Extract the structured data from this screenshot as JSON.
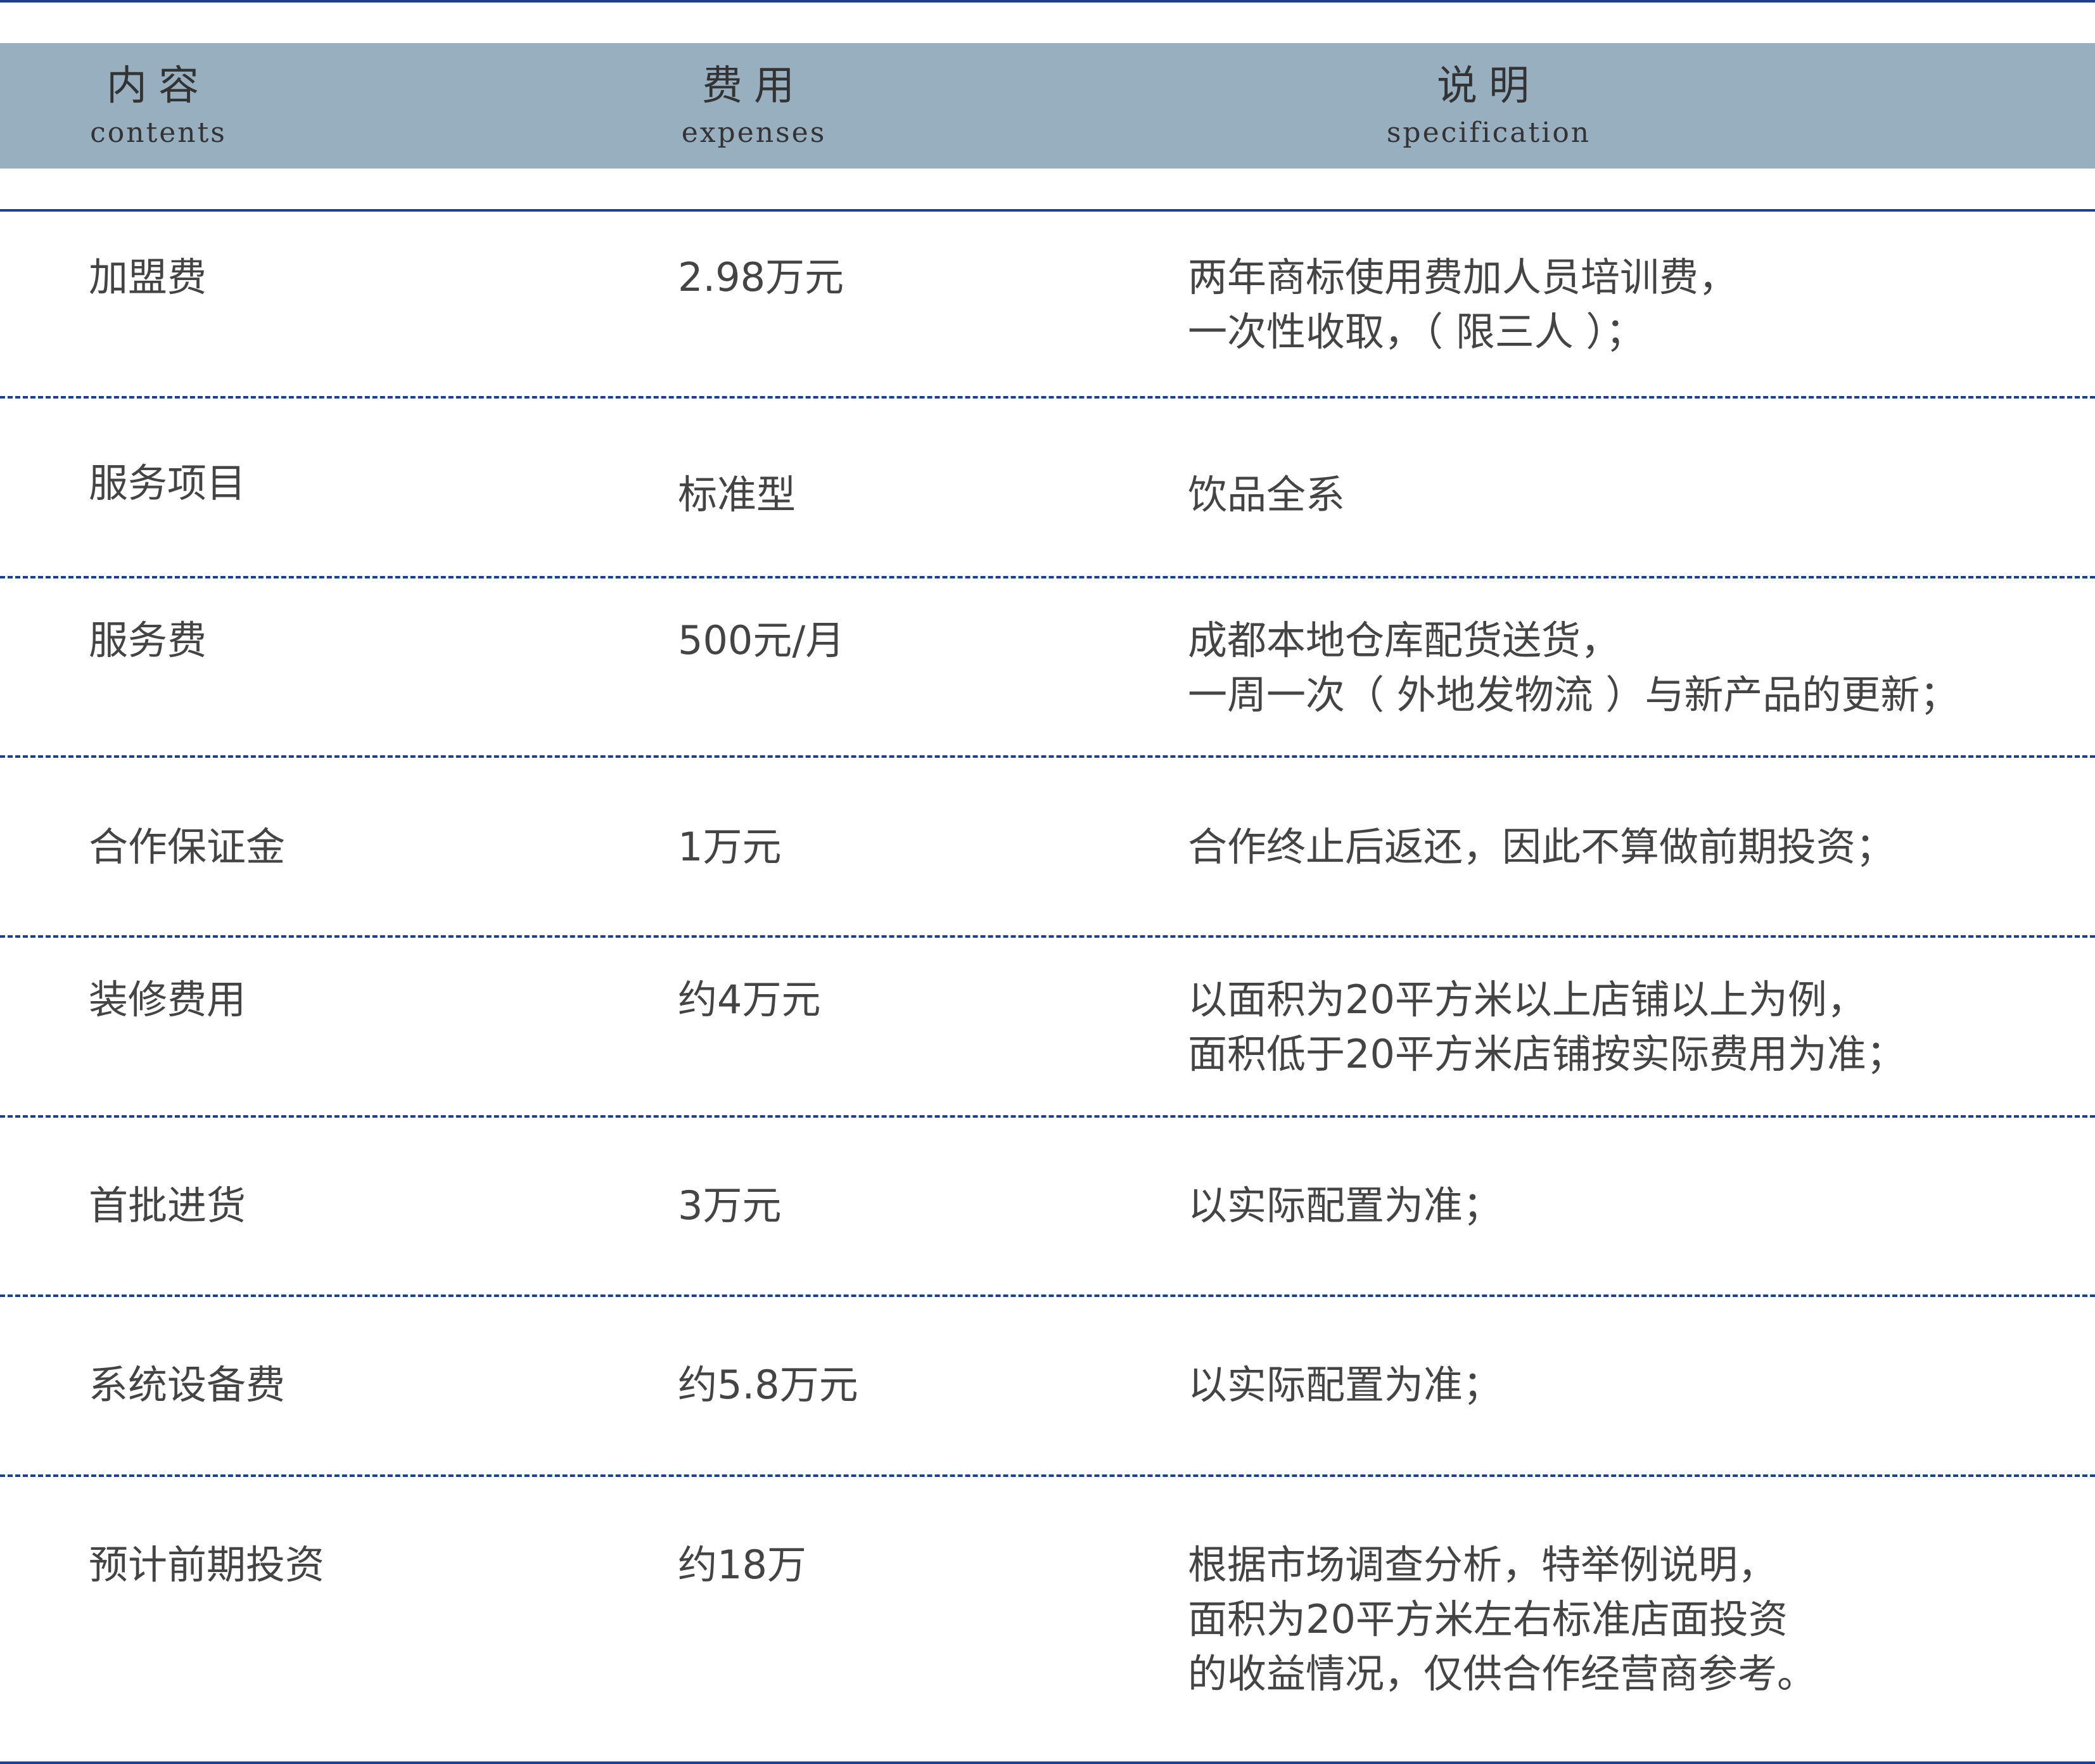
{
  "header": {
    "col1": {
      "zh": "内容",
      "en": "contents"
    },
    "col2": {
      "zh": "费用",
      "en": "expenses"
    },
    "col3": {
      "zh": "说明",
      "en": "specification"
    }
  },
  "rows": [
    {
      "item": "加盟费",
      "expense": "2.98万元",
      "spec": [
        "两年商标使用费加人员培训费，",
        "一次性收取，（ 限三人 ）；"
      ]
    },
    {
      "item": "服务项目",
      "expense": "标准型",
      "spec": [
        "饮品全系"
      ]
    },
    {
      "item": "服务费",
      "expense": "500元/月",
      "spec": [
        "成都本地仓库配货送货，",
        "一周一次（ 外地发物流 ）与新产品的更新；"
      ]
    },
    {
      "item": "合作保证金",
      "expense": "1万元",
      "spec": [
        "合作终止后返还，因此不算做前期投资；"
      ]
    },
    {
      "item": "装修费用",
      "expense": "约4万元",
      "spec": [
        "以面积为20平方米以上店铺以上为例，",
        "面积低于20平方米店铺按实际费用为准；"
      ]
    },
    {
      "item": "首批进货",
      "expense": "3万元",
      "spec": [
        "以实际配置为准；"
      ]
    },
    {
      "item": "系统设备费",
      "expense": "约5.8万元",
      "spec": [
        "以实际配置为准；"
      ]
    },
    {
      "item": "预计前期投资",
      "expense": "约18万",
      "spec": [
        "根据市场调查分析，特举例说明，",
        "面积为20平方米左右标准店面投资",
        "的收益情况，仅供合作经营商参考。"
      ]
    }
  ],
  "colors": {
    "header_bg": "#98afc0",
    "rule": "#1f3f8c",
    "text": "#444444"
  }
}
